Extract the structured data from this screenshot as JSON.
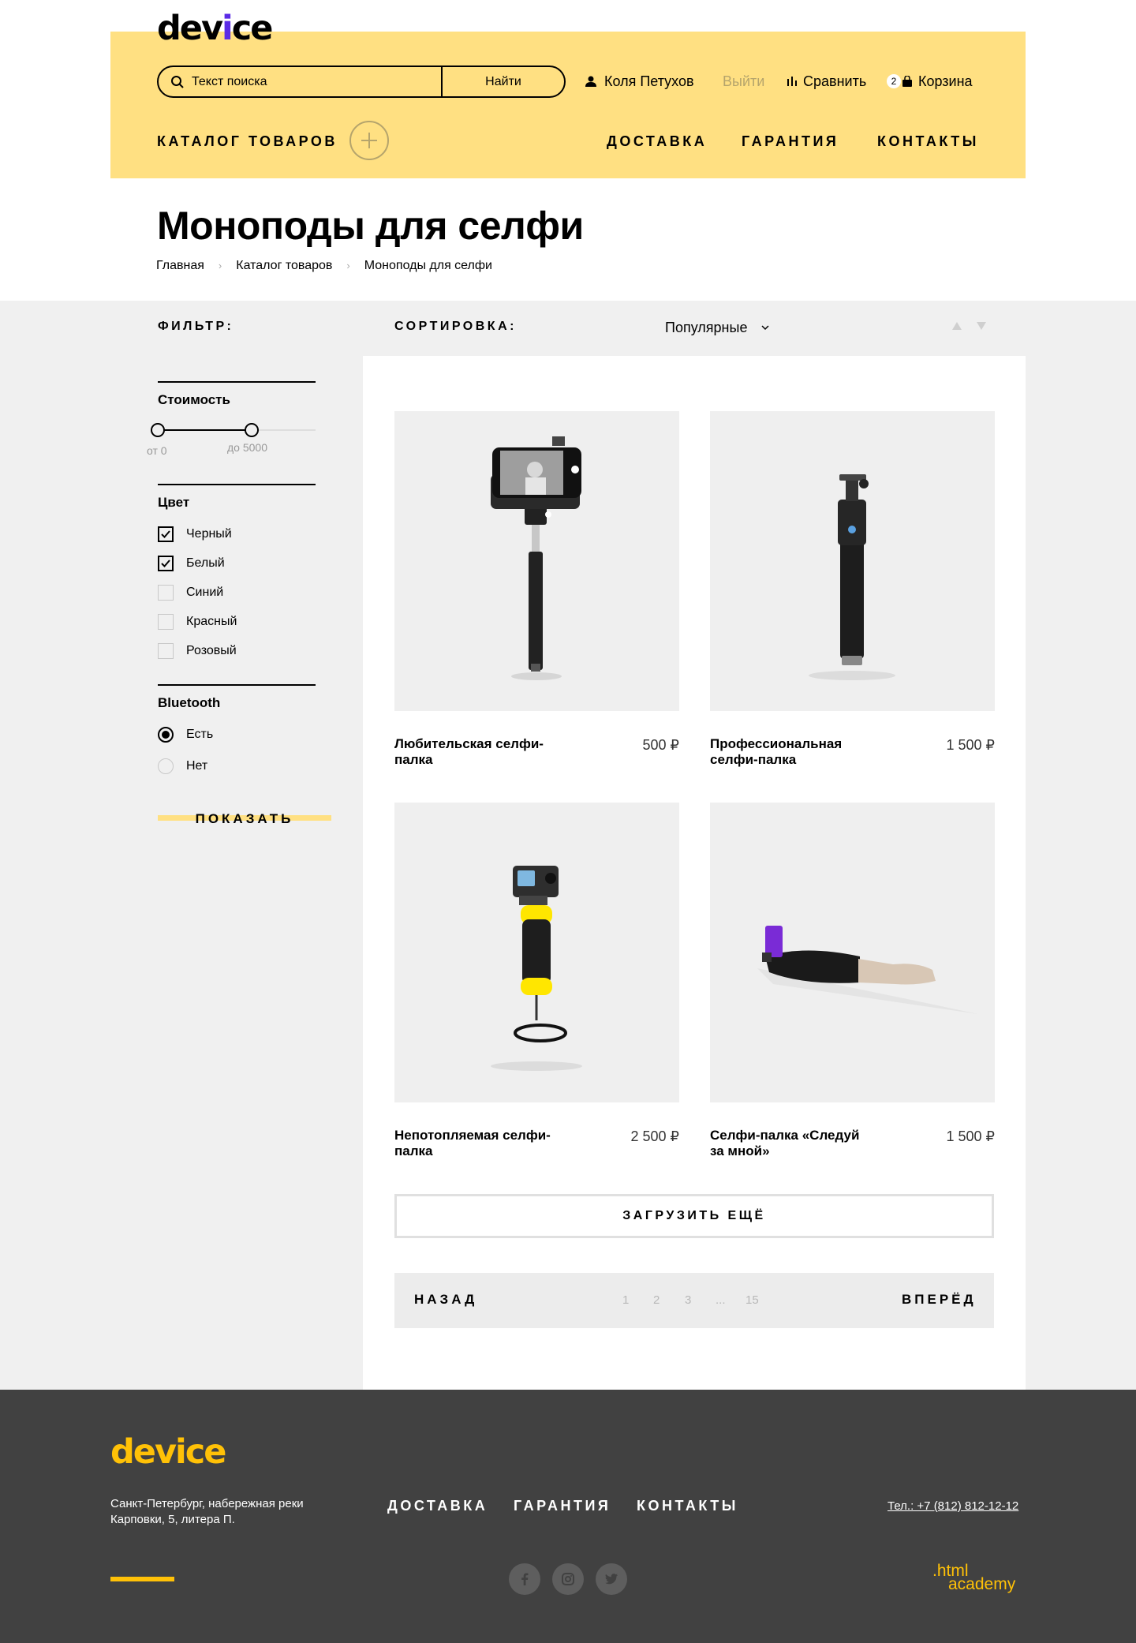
{
  "header": {
    "logo": {
      "part1": "dev",
      "part2": "i",
      "part3": "ce"
    },
    "search": {
      "placeholder": "Текст поиска",
      "button": "Найти"
    },
    "user": {
      "name": "Коля Петухов",
      "logout": "Выйти"
    },
    "compare": "Сравнить",
    "cart": {
      "count": "2",
      "label": "Корзина"
    },
    "catalog": "КАТАЛОГ ТОВАРОВ",
    "nav": [
      "ДОСТАВКА",
      "ГАРАНТИЯ",
      "КОНТАКТЫ"
    ]
  },
  "page": {
    "title": "Моноподы для селфи",
    "breadcrumb": [
      "Главная",
      "Каталог товаров",
      "Моноподы для селфи"
    ]
  },
  "filter": {
    "title": "ФИЛЬТР:",
    "price": {
      "heading": "Стоимость",
      "min_label": "от 0",
      "max_label": "до 5000",
      "min": 0,
      "max": 5000,
      "range_fraction": 0.595
    },
    "color": {
      "heading": "Цвет",
      "options": [
        {
          "label": "Черный",
          "checked": true
        },
        {
          "label": "Белый",
          "checked": true
        },
        {
          "label": "Синий",
          "checked": false
        },
        {
          "label": "Красный",
          "checked": false
        },
        {
          "label": "Розовый",
          "checked": false
        }
      ]
    },
    "bluetooth": {
      "heading": "Bluetooth",
      "options": [
        {
          "label": "Есть",
          "selected": true
        },
        {
          "label": "Нет",
          "selected": false
        }
      ]
    },
    "show_button": "ПОКАЗАТЬ"
  },
  "sort": {
    "title": "СОРТИРОВКА:",
    "selected": "Популярные"
  },
  "products": [
    {
      "name": "Любительская селфи-палка",
      "price": "500 ₽",
      "image": "selfie-stick-phone"
    },
    {
      "name": "Профессиональная селфи-палка",
      "price": "1 500 ₽",
      "image": "selfie-stick-pro"
    },
    {
      "name": "Непотопляемая селфи-палка",
      "price": "2 500 ₽",
      "image": "floating-grip-camera"
    },
    {
      "name": "Селфи-палка «Следуй за мной»",
      "price": "1 500 ₽",
      "image": "mannequin-arm-stick"
    }
  ],
  "load_more": "ЗАГРУЗИТЬ ЕЩЁ",
  "pagination": {
    "prev": "НАЗАД",
    "next": "ВПЕРЁД",
    "pages": [
      "1",
      "2",
      "3",
      "...",
      "15"
    ]
  },
  "footer": {
    "logo": "device",
    "address": "Санкт-Петербург, набережная реки Карповки, 5, литера П.",
    "nav": [
      "ДОСТАВКА",
      "ГАРАНТИЯ",
      "КОНТАКТЫ"
    ],
    "phone": "Тел.: +7 (812) 812-12-12",
    "academy": {
      "line1": ".html",
      "line2": "academy"
    },
    "socials": [
      "facebook-icon",
      "instagram-icon",
      "twitter-icon"
    ]
  },
  "colors": {
    "header_bg": "#ffe082",
    "accent_yellow": "#ffc107",
    "footer_bg": "#414141",
    "main_bg": "#f0f0f0",
    "logo_accent": "#5b2be6"
  }
}
